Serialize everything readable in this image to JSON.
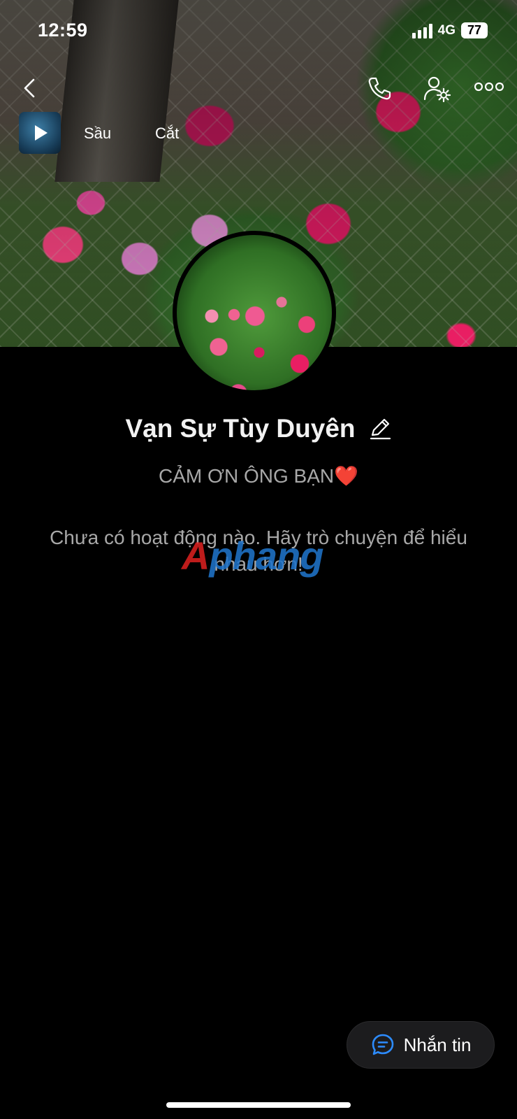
{
  "status_bar": {
    "time": "12:59",
    "network": "4G",
    "battery": "77"
  },
  "music": {
    "title": "Sầu",
    "artist": "Cắt"
  },
  "profile": {
    "name": "Vạn Sự Tùy Duyên",
    "bio_text": "CẢM ƠN ÔNG BẠN",
    "bio_emoji": "❤️",
    "empty_state": "Chưa có hoạt động nào. Hãy trò chuyện để hiểu nhau hơn!"
  },
  "watermark": {
    "first_letter": "A",
    "rest": "phang"
  },
  "actions": {
    "message_label": "Nhắn tin"
  },
  "colors": {
    "background": "#000000",
    "accent_blue": "#2d8cff",
    "heart_red": "#e0245e",
    "muted_text": "#a8a8a8"
  }
}
